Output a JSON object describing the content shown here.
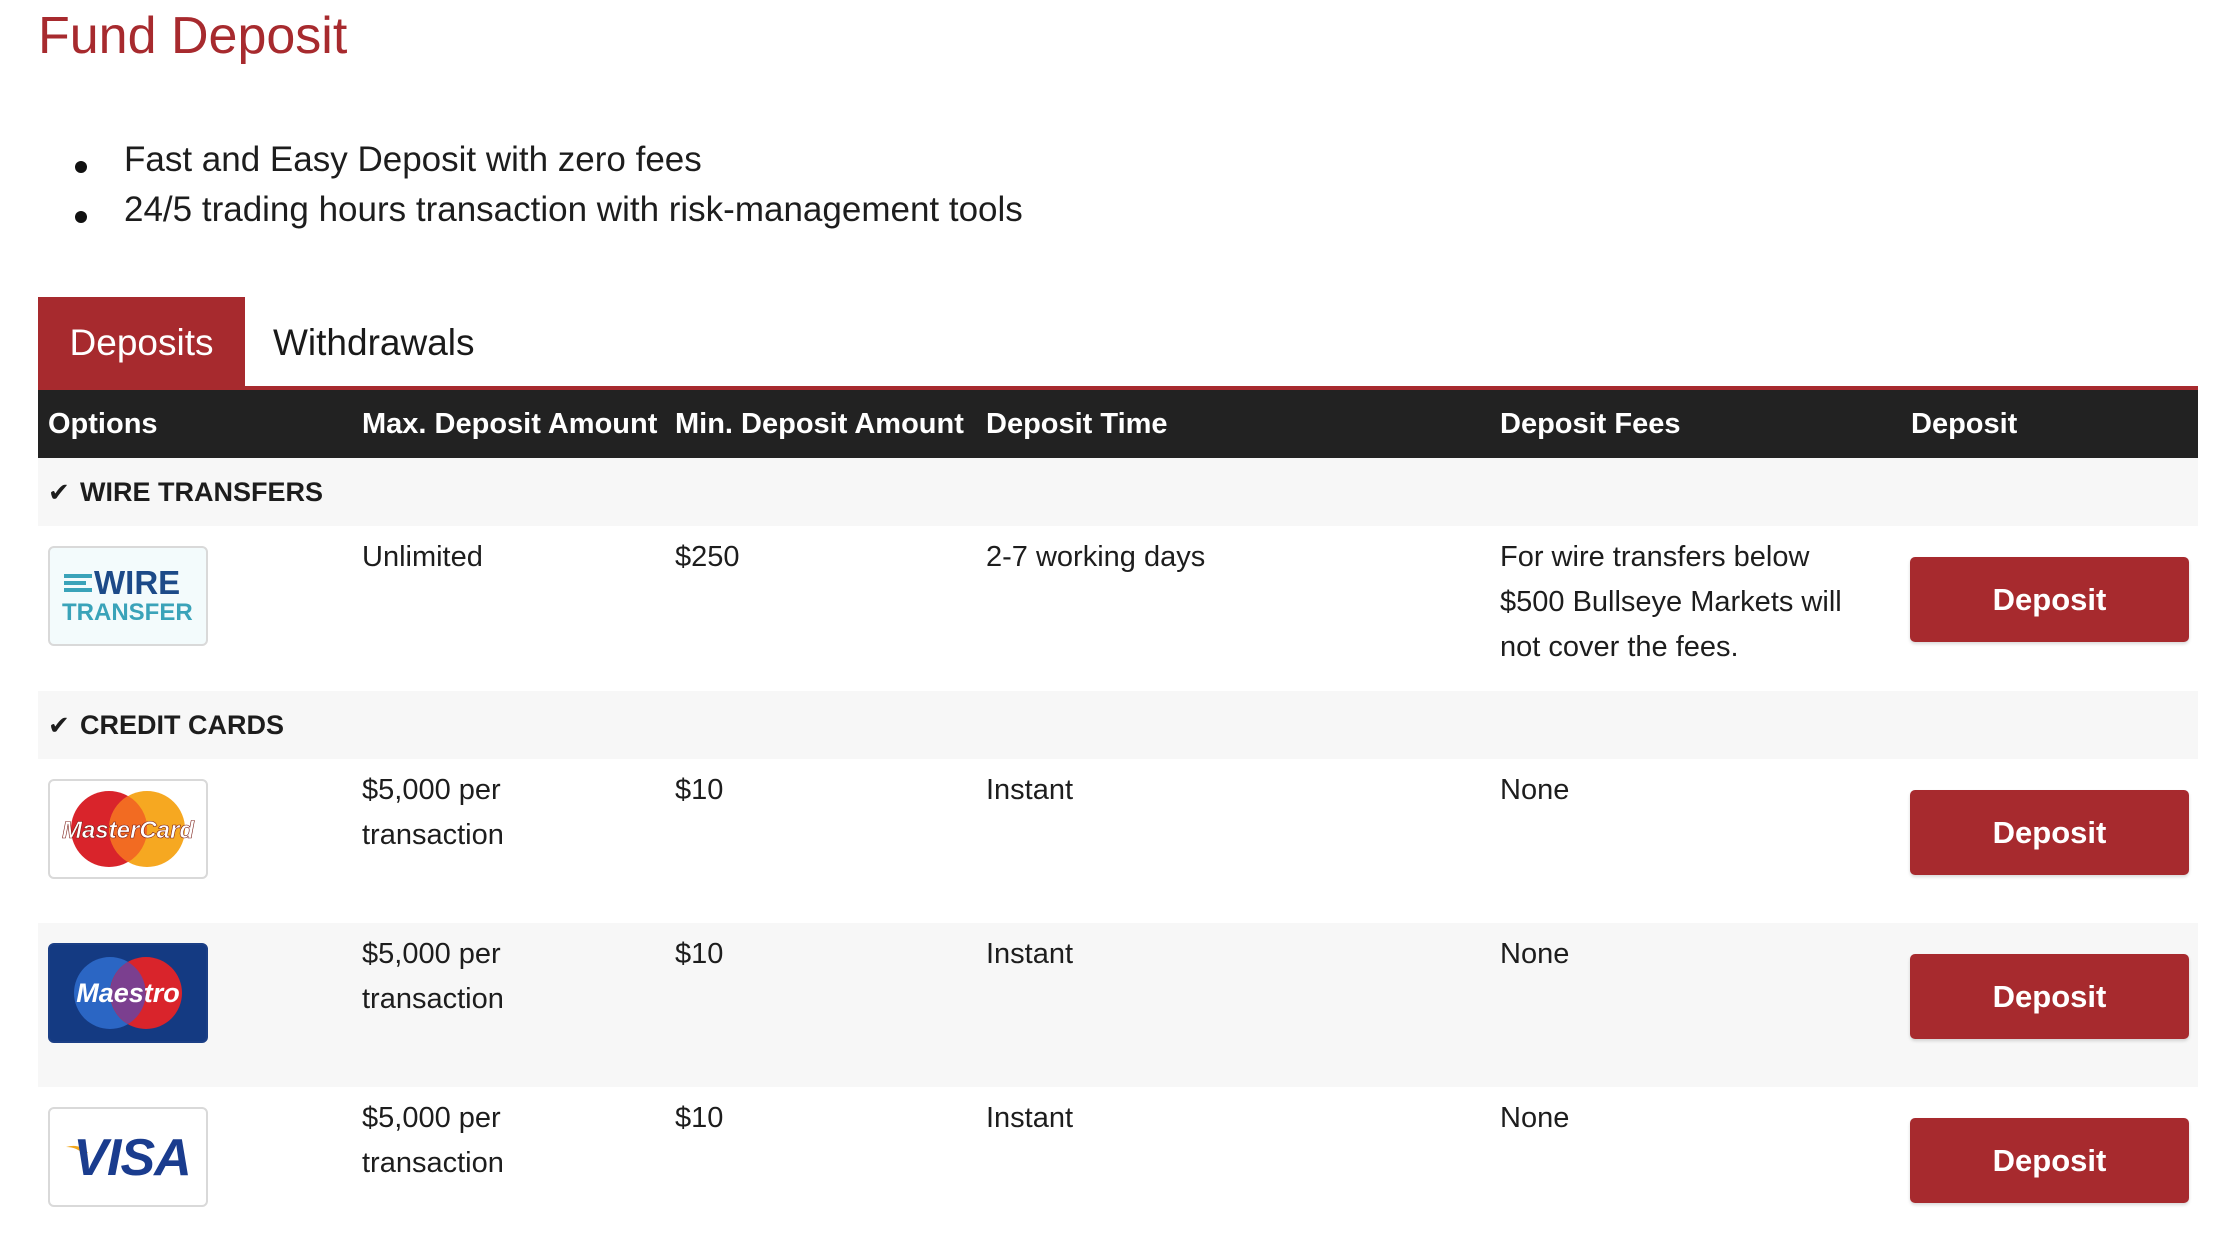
{
  "page": {
    "title": "Fund Deposit",
    "bullets": [
      "Fast and Easy Deposit with zero fees",
      "24/5 trading hours transaction with risk-management tools"
    ]
  },
  "tabs": [
    {
      "label": "Deposits",
      "active": true
    },
    {
      "label": "Withdrawals",
      "active": false
    }
  ],
  "table": {
    "headers": [
      "Options",
      "Max. Deposit Amount",
      "Min. Deposit Amount",
      "Deposit Time",
      "Deposit Fees",
      "Deposit"
    ],
    "sections": [
      {
        "label": "WIRE TRANSFERS",
        "rows": [
          {
            "logo": "wire-transfer-logo",
            "logo_text": [
              "WIRE",
              "TRANSFER"
            ],
            "max": "Unlimited",
            "min": "$250",
            "time": "2-7 working days",
            "fees": "For wire transfers below $500 Bullseye Markets will not cover the fees.",
            "button": "Deposit"
          }
        ]
      },
      {
        "label": "CREDIT CARDS",
        "rows": [
          {
            "logo": "mastercard-logo",
            "logo_text": "MasterCard",
            "max": "$5,000 per transaction",
            "min": "$10",
            "time": "Instant",
            "fees": "None",
            "button": "Deposit"
          },
          {
            "logo": "maestro-logo",
            "logo_text": "Maestro",
            "max": "$5,000 per transaction",
            "min": "$10",
            "time": "Instant",
            "fees": "None",
            "button": "Deposit"
          },
          {
            "logo": "visa-logo",
            "logo_text": "VISA",
            "max": "$5,000 per transaction",
            "min": "$10",
            "time": "Instant",
            "fees": "None",
            "button": "Deposit"
          }
        ]
      }
    ]
  },
  "colors": {
    "accent": "#a72a2e",
    "header_bg": "#222222",
    "section_bg": "#f7f7f7"
  }
}
